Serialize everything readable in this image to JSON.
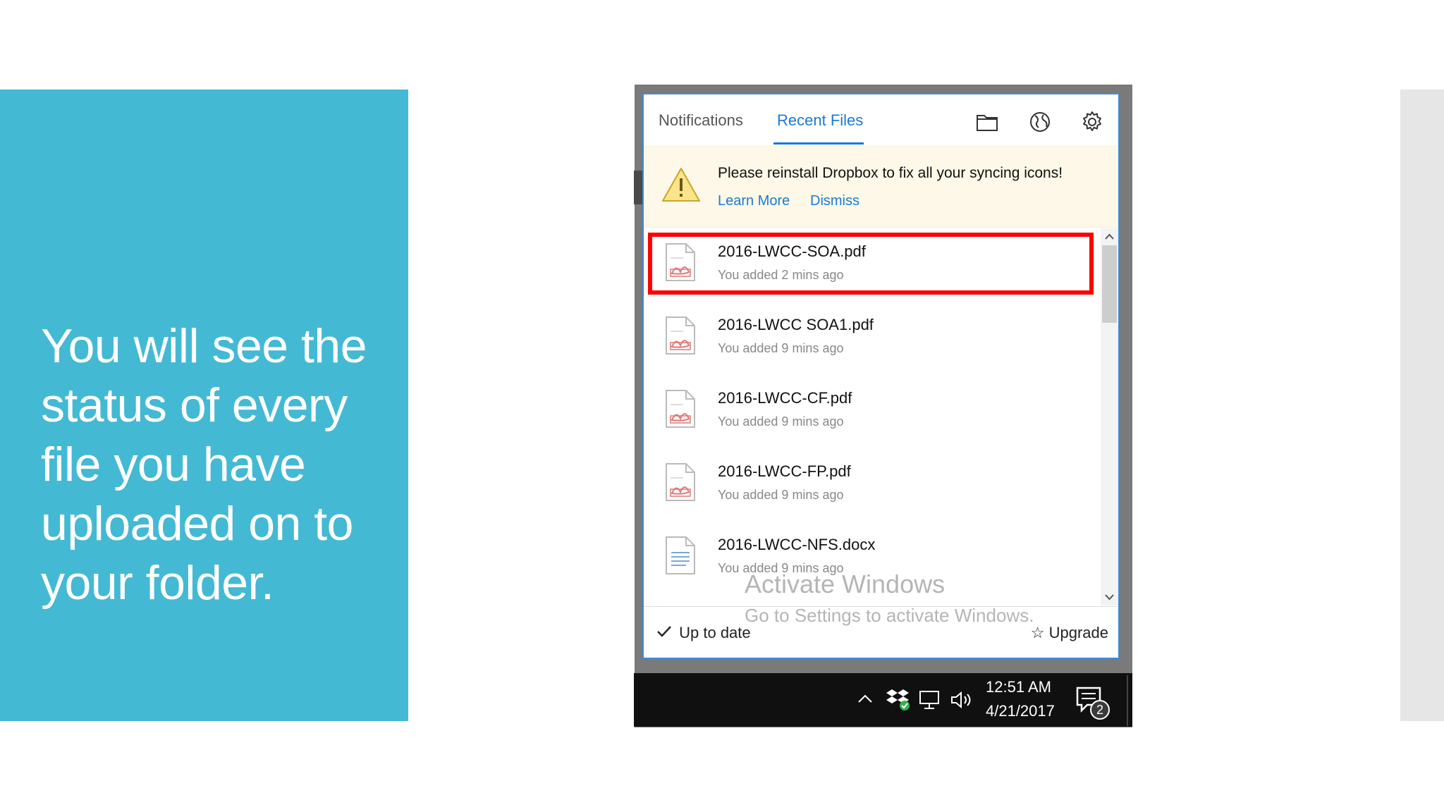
{
  "slide": {
    "body_text": "You will see the status of every file you have uploaded on to your folder."
  },
  "popup": {
    "tabs": [
      {
        "label": "Notifications"
      },
      {
        "label": "Recent Files",
        "active": true
      }
    ],
    "header_icons": [
      "folder-icon",
      "globe-icon",
      "gear-icon"
    ],
    "banner": {
      "message": "Please reinstall Dropbox to fix all your syncing icons!",
      "learn_more": "Learn More",
      "dismiss": "Dismiss",
      "icon": "warning-icon"
    },
    "files": [
      {
        "name": "2016-LWCC-SOA.pdf",
        "meta": "You added 2 mins ago",
        "type": "pdf",
        "highlighted": true
      },
      {
        "name": "2016-LWCC SOA1.pdf",
        "meta": "You added 9 mins ago",
        "type": "pdf"
      },
      {
        "name": "2016-LWCC-CF.pdf",
        "meta": "You added 9 mins ago",
        "type": "pdf"
      },
      {
        "name": "2016-LWCC-FP.pdf",
        "meta": "You added 9 mins ago",
        "type": "pdf"
      },
      {
        "name": "2016-LWCC-NFS.docx",
        "meta": "You added 9 mins ago",
        "type": "docx"
      }
    ],
    "footer": {
      "status": "Up to date",
      "upgrade": "Upgrade"
    }
  },
  "watermark": {
    "line1": "Activate Windows",
    "line2": "Go to Settings to activate Windows."
  },
  "taskbar": {
    "time": "12:51 AM",
    "date": "4/21/2017",
    "notification_count": "2"
  },
  "colors": {
    "slide_panel": "#44b9d4",
    "accent_blue": "#1a7ad6",
    "highlight_red": "#ff0000",
    "banner_bg": "#fdf8e7"
  }
}
